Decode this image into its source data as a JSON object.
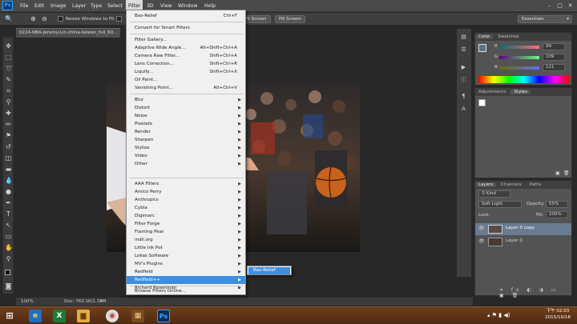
{
  "menubar": {
    "items": [
      "File",
      "Edit",
      "Image",
      "Layer",
      "Type",
      "Select",
      "Filter",
      "3D",
      "View",
      "Window",
      "Help"
    ],
    "active": "Filter"
  },
  "options": {
    "resize_label": "Resize Windows to Fit",
    "fit_screen": "Fit Screen",
    "fill_screen": "Fill Screen",
    "workspace": "Essentials"
  },
  "document": {
    "tab_title": "0224-NBA-Jeremy-Lin-china-taiwan_full_60...",
    "zoom": "100%",
    "doc_info": "Doc: 763.1K/1.37M"
  },
  "filter_menu": {
    "last_filter": {
      "label": "Bas-Relief",
      "shortcut": "Ctrl+F"
    },
    "convert": "Convert for Smart Filters",
    "group1": [
      {
        "label": "Filter Gallery...",
        "shortcut": ""
      },
      {
        "label": "Adaptive Wide Angle...",
        "shortcut": "Alt+Shift+Ctrl+A"
      },
      {
        "label": "Camera Raw Filter...",
        "shortcut": "Shift+Ctrl+A"
      },
      {
        "label": "Lens Correction...",
        "shortcut": "Shift+Ctrl+R"
      },
      {
        "label": "Liquify...",
        "shortcut": "Shift+Ctrl+X"
      },
      {
        "label": "Oil Paint...",
        "shortcut": ""
      },
      {
        "label": "Vanishing Point...",
        "shortcut": "Alt+Ctrl+V"
      }
    ],
    "group2": [
      "Blur",
      "Distort",
      "Noise",
      "Pixelate",
      "Render",
      "Sharpen",
      "Stylize",
      "Video",
      "Other"
    ],
    "group3": [
      "AAA Filters",
      "Amico Perry",
      "Anthropics",
      "Cybia",
      "Digimarc",
      "Filter Forge",
      "Flaming Pear",
      "indii.org",
      "Little Ink Pot",
      "Lokas Software",
      "MV's Plugins",
      "Redfield",
      "Redfield++",
      "Richard Rosenman"
    ],
    "browse": "Browse Filters Online...",
    "highlighted": "Redfield++",
    "submenu_item": "Bas-Relief"
  },
  "color_panel": {
    "tabs": [
      "Color",
      "Swatches"
    ],
    "r": "99",
    "g": "109",
    "b": "121",
    "labels": [
      "R",
      "G",
      "B"
    ]
  },
  "adjust_panel": {
    "tabs": [
      "Adjustments",
      "Styles"
    ]
  },
  "layers_panel": {
    "tabs": [
      "Layers",
      "Channels",
      "Paths"
    ],
    "kind": "Kind",
    "blend_mode": "Soft Light",
    "opacity_label": "Opacity:",
    "opacity": "55%",
    "lock_label": "Lock:",
    "fill_label": "Fill:",
    "fill": "100%",
    "layers": [
      {
        "name": "Layer 0 copy",
        "selected": true
      },
      {
        "name": "Layer 0",
        "selected": false
      }
    ]
  },
  "taskbar": {
    "time": "下午 02:03",
    "date": "2015/10/18"
  }
}
